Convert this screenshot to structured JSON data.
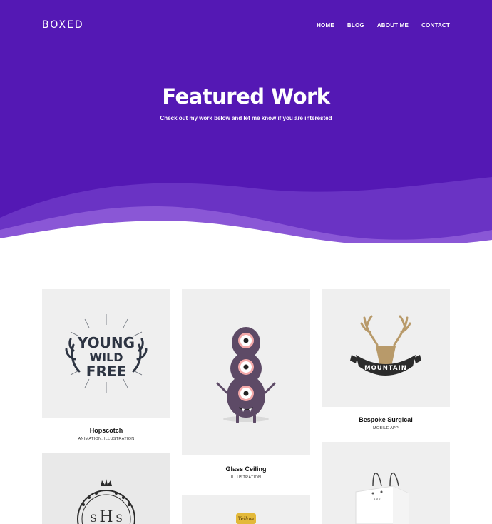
{
  "brand": {
    "logo_text": "BOXED"
  },
  "nav": {
    "items": [
      {
        "label": "HOME"
      },
      {
        "label": "BLOG"
      },
      {
        "label": "ABOUT ME"
      },
      {
        "label": "CONTACT"
      }
    ]
  },
  "hero": {
    "title": "Featured Work",
    "subtitle": "Check out my work below and let me know if you are interested",
    "bg_color": "#5418b4",
    "wave_color": "#8a57d6"
  },
  "portfolio": {
    "items": [
      {
        "title": "Hopscotch",
        "tags": "ANIMATION, ILLUSTRATION",
        "art_text": [
          "YOUNG",
          "WILD",
          "FREE"
        ]
      },
      {
        "title": "Glass Ceiling",
        "tags": "ILLUSTRATION"
      },
      {
        "title": "Bespoke Surgical",
        "tags": "MOBILE APP",
        "art_text": "MOUNTAIN"
      },
      {
        "art_text": [
          "S",
          "H",
          "S"
        ]
      },
      {
        "art_text": "Yellow"
      },
      {
        "art_text": "APP"
      }
    ]
  }
}
